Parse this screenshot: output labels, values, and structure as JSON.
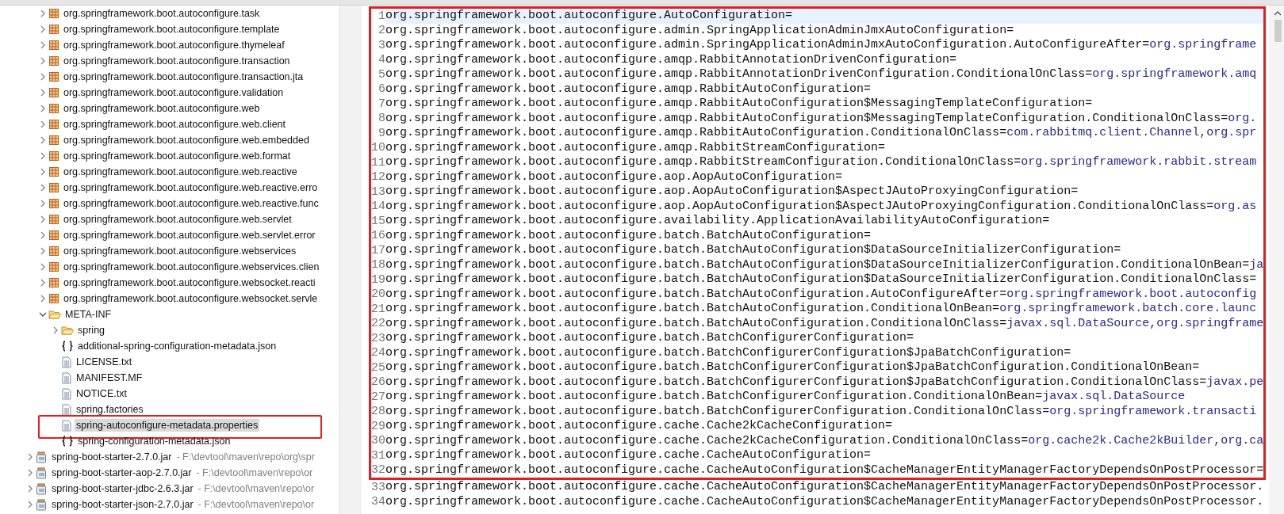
{
  "tree": {
    "nested_items": [
      {
        "label": "org.springframework.boot.autoconfigure.task",
        "kind": "package",
        "expanded": false,
        "selected": false
      },
      {
        "label": "org.springframework.boot.autoconfigure.template",
        "kind": "package",
        "expanded": false,
        "selected": false
      },
      {
        "label": "org.springframework.boot.autoconfigure.thymeleaf",
        "kind": "package",
        "expanded": false,
        "selected": false
      },
      {
        "label": "org.springframework.boot.autoconfigure.transaction",
        "kind": "package",
        "expanded": false,
        "selected": false
      },
      {
        "label": "org.springframework.boot.autoconfigure.transaction.jta",
        "kind": "package",
        "expanded": false,
        "selected": false
      },
      {
        "label": "org.springframework.boot.autoconfigure.validation",
        "kind": "package",
        "expanded": false,
        "selected": false
      },
      {
        "label": "org.springframework.boot.autoconfigure.web",
        "kind": "package",
        "expanded": false,
        "selected": false
      },
      {
        "label": "org.springframework.boot.autoconfigure.web.client",
        "kind": "package",
        "expanded": false,
        "selected": false
      },
      {
        "label": "org.springframework.boot.autoconfigure.web.embedded",
        "kind": "package",
        "expanded": false,
        "selected": false
      },
      {
        "label": "org.springframework.boot.autoconfigure.web.format",
        "kind": "package",
        "expanded": false,
        "selected": false
      },
      {
        "label": "org.springframework.boot.autoconfigure.web.reactive",
        "kind": "package",
        "expanded": false,
        "selected": false
      },
      {
        "label": "org.springframework.boot.autoconfigure.web.reactive.erro",
        "kind": "package",
        "expanded": false,
        "selected": false
      },
      {
        "label": "org.springframework.boot.autoconfigure.web.reactive.func",
        "kind": "package",
        "expanded": false,
        "selected": false
      },
      {
        "label": "org.springframework.boot.autoconfigure.web.servlet",
        "kind": "package",
        "expanded": false,
        "selected": false
      },
      {
        "label": "org.springframework.boot.autoconfigure.web.servlet.error",
        "kind": "package",
        "expanded": false,
        "selected": false
      },
      {
        "label": "org.springframework.boot.autoconfigure.webservices",
        "kind": "package",
        "expanded": false,
        "selected": false
      },
      {
        "label": "org.springframework.boot.autoconfigure.webservices.clien",
        "kind": "package",
        "expanded": false,
        "selected": false
      },
      {
        "label": "org.springframework.boot.autoconfigure.websocket.reacti",
        "kind": "package",
        "expanded": false,
        "selected": false
      },
      {
        "label": "org.springframework.boot.autoconfigure.websocket.servle",
        "kind": "package",
        "expanded": false,
        "selected": false
      },
      {
        "label": "META-INF",
        "kind": "folder",
        "expanded": true,
        "selected": false,
        "children": [
          {
            "label": "spring",
            "kind": "folder",
            "expanded": false,
            "selected": false,
            "boxed": false
          },
          {
            "label": "additional-spring-configuration-metadata.json",
            "kind": "json",
            "selected": false,
            "boxed": false
          },
          {
            "label": "LICENSE.txt",
            "kind": "text",
            "selected": false,
            "boxed": false
          },
          {
            "label": "MANIFEST.MF",
            "kind": "text",
            "selected": false,
            "boxed": false
          },
          {
            "label": "NOTICE.txt",
            "kind": "text",
            "selected": false,
            "boxed": false
          },
          {
            "label": "spring.factories",
            "kind": "text",
            "selected": false,
            "boxed": false
          },
          {
            "label": "spring-autoconfigure-metadata.properties",
            "kind": "text",
            "selected": true,
            "boxed": true
          },
          {
            "label": "spring-configuration-metadata.json",
            "kind": "json",
            "selected": false,
            "boxed": false
          }
        ]
      }
    ],
    "items": [
      {
        "label": "spring-boot-starter-2.7.0.jar",
        "path": "- F:\\devtool\\maven\\repo\\org\\spr",
        "kind": "jar",
        "expanded": false,
        "selected": false
      },
      {
        "label": "spring-boot-starter-aop-2.7.0.jar",
        "path": "- F:\\devtool\\maven\\repo\\or",
        "kind": "jar",
        "expanded": false,
        "selected": false
      },
      {
        "label": "spring-boot-starter-jdbc-2.6.3.jar",
        "path": "- F:\\devtool\\maven\\repo\\or",
        "kind": "jar",
        "expanded": false,
        "selected": false
      },
      {
        "label": "spring-boot-starter-json-2.7.0.jar",
        "path": "- F:\\devtool\\maven\\repo\\or",
        "kind": "jar",
        "expanded": false,
        "selected": false
      }
    ]
  },
  "editor": {
    "framed": true,
    "framed_lines": [
      {
        "number": "1",
        "key": "org.springframework.boot.autoconfigure.AutoConfiguration=",
        "current": true
      },
      {
        "number": "2",
        "key": "org.springframework.boot.autoconfigure.admin.SpringApplicationAdminJmxAutoConfiguration=",
        "current": false
      },
      {
        "number": "3",
        "key": "org.springframework.boot.autoconfigure.admin.SpringApplicationAdminJmxAutoConfiguration.AutoConfigureAfter=",
        "value": "org.springframe",
        "current": false
      },
      {
        "number": "4",
        "key": "org.springframework.boot.autoconfigure.amqp.RabbitAnnotationDrivenConfiguration=",
        "current": false
      },
      {
        "number": "5",
        "key": "org.springframework.boot.autoconfigure.amqp.RabbitAnnotationDrivenConfiguration.ConditionalOnClass=",
        "value": "org.springframework.amq",
        "current": false
      },
      {
        "number": "6",
        "key": "org.springframework.boot.autoconfigure.amqp.RabbitAutoConfiguration=",
        "current": false
      },
      {
        "number": "7",
        "key": "org.springframework.boot.autoconfigure.amqp.RabbitAutoConfiguration$MessagingTemplateConfiguration=",
        "current": false
      },
      {
        "number": "8",
        "key": "org.springframework.boot.autoconfigure.amqp.RabbitAutoConfiguration$MessagingTemplateConfiguration.ConditionalOnClass=",
        "value": "org.",
        "current": false
      },
      {
        "number": "9",
        "key": "org.springframework.boot.autoconfigure.amqp.RabbitAutoConfiguration.ConditionalOnClass=",
        "value": "com.rabbitmq.client.Channel,org.spr",
        "current": false
      },
      {
        "number": "10",
        "key": "org.springframework.boot.autoconfigure.amqp.RabbitStreamConfiguration=",
        "current": false
      },
      {
        "number": "11",
        "key": "org.springframework.boot.autoconfigure.amqp.RabbitStreamConfiguration.ConditionalOnClass=",
        "value": "org.springframework.rabbit.stream",
        "current": false
      },
      {
        "number": "12",
        "key": "org.springframework.boot.autoconfigure.aop.AopAutoConfiguration=",
        "current": false
      },
      {
        "number": "13",
        "key": "org.springframework.boot.autoconfigure.aop.AopAutoConfiguration$AspectJAutoProxyingConfiguration=",
        "current": false
      },
      {
        "number": "14",
        "key": "org.springframework.boot.autoconfigure.aop.AopAutoConfiguration$AspectJAutoProxyingConfiguration.ConditionalOnClass=",
        "value": "org.as",
        "current": false
      },
      {
        "number": "15",
        "key": "org.springframework.boot.autoconfigure.availability.ApplicationAvailabilityAutoConfiguration=",
        "current": false
      },
      {
        "number": "16",
        "key": "org.springframework.boot.autoconfigure.batch.BatchAutoConfiguration=",
        "current": false
      },
      {
        "number": "17",
        "key": "org.springframework.boot.autoconfigure.batch.BatchAutoConfiguration$DataSourceInitializerConfiguration=",
        "current": false
      },
      {
        "number": "18",
        "key": "org.springframework.boot.autoconfigure.batch.BatchAutoConfiguration$DataSourceInitializerConfiguration.ConditionalOnBean=",
        "value": "ja",
        "current": false
      },
      {
        "number": "19",
        "key": "org.springframework.boot.autoconfigure.batch.BatchAutoConfiguration$DataSourceInitializerConfiguration.ConditionalOnClass=",
        "current": false
      },
      {
        "number": "20",
        "key": "org.springframework.boot.autoconfigure.batch.BatchAutoConfiguration.AutoConfigureAfter=",
        "value": "org.springframework.boot.autoconfig",
        "current": false
      },
      {
        "number": "21",
        "key": "org.springframework.boot.autoconfigure.batch.BatchAutoConfiguration.ConditionalOnBean=",
        "value": "org.springframework.batch.core.launc",
        "current": false
      },
      {
        "number": "22",
        "key": "org.springframework.boot.autoconfigure.batch.BatchAutoConfiguration.ConditionalOnClass=",
        "value": "javax.sql.DataSource,org.springframe",
        "current": false
      },
      {
        "number": "23",
        "key": "org.springframework.boot.autoconfigure.batch.BatchConfigurerConfiguration=",
        "current": false
      },
      {
        "number": "24",
        "key": "org.springframework.boot.autoconfigure.batch.BatchConfigurerConfiguration$JpaBatchConfiguration=",
        "current": false
      },
      {
        "number": "25",
        "key": "org.springframework.boot.autoconfigure.batch.BatchConfigurerConfiguration$JpaBatchConfiguration.ConditionalOnBean=",
        "current": false
      },
      {
        "number": "26",
        "key": "org.springframework.boot.autoconfigure.batch.BatchConfigurerConfiguration$JpaBatchConfiguration.ConditionalOnClass=",
        "value": "javax.pe",
        "current": false
      },
      {
        "number": "27",
        "key": "org.springframework.boot.autoconfigure.batch.BatchConfigurerConfiguration.ConditionalOnBean=",
        "value": "javax.sql.DataSource",
        "current": false
      },
      {
        "number": "28",
        "key": "org.springframework.boot.autoconfigure.batch.BatchConfigurerConfiguration.ConditionalOnClass=",
        "value": "org.springframework.transacti",
        "current": false
      },
      {
        "number": "29",
        "key": "org.springframework.boot.autoconfigure.cache.Cache2kCacheConfiguration=",
        "current": false
      },
      {
        "number": "30",
        "key": "org.springframework.boot.autoconfigure.cache.Cache2kCacheConfiguration.ConditionalOnClass=",
        "value": "org.cache2k.Cache2kBuilder,org.ca",
        "current": false
      },
      {
        "number": "31",
        "key": "org.springframework.boot.autoconfigure.cache.CacheAutoConfiguration=",
        "current": false
      },
      {
        "number": "32",
        "key": "org.springframework.boot.autoconfigure.cache.CacheAutoConfiguration$CacheManagerEntityManagerFactoryDependsOnPostProcessor=",
        "current": false
      }
    ],
    "lines": [
      {
        "number": "33",
        "key": "org.springframework.boot.autoconfigure.cache.CacheAutoConfiguration$CacheManagerEntityManagerFactoryDependsOnPostProcessor.",
        "current": false
      },
      {
        "number": "34",
        "key": "org.springframework.boot.autoconfigure.cache.CacheAutoConfiguration$CacheManagerEntityManagerFactoryDependsOnPostProcessor.",
        "current": false
      }
    ]
  }
}
